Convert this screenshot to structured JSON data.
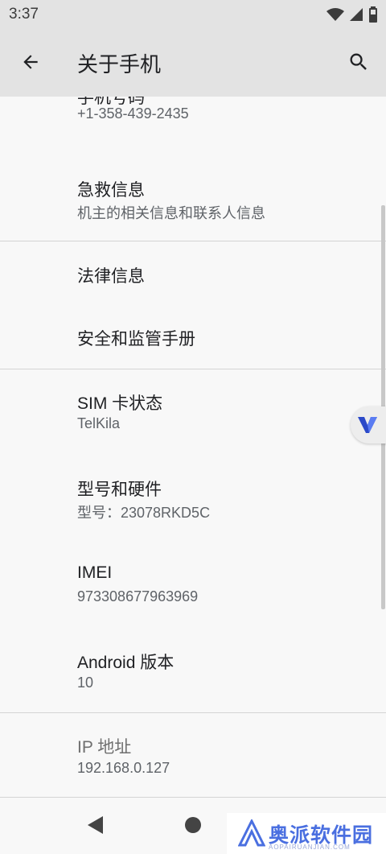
{
  "status_bar": {
    "time": "3:37"
  },
  "header": {
    "title": "关于手机"
  },
  "items": [
    {
      "title": "手机号码",
      "subtitle": "+1-358-439-2435"
    },
    {
      "title": "急救信息",
      "subtitle": "机主的相关信息和联系人信息"
    },
    {
      "title": "法律信息"
    },
    {
      "title": "安全和监管手册"
    },
    {
      "title": "SIM 卡状态",
      "subtitle": "TelKila"
    },
    {
      "title": "型号和硬件",
      "subtitle": "型号：23078RKD5C"
    },
    {
      "title": "IMEI",
      "subtitle": "973308677963969"
    },
    {
      "title": "Android 版本",
      "subtitle": "10"
    },
    {
      "title": "IP 地址",
      "subtitle": "192.168.0.127"
    }
  ],
  "watermark": {
    "text": "奥派软件园",
    "sub": "AOPAIRUANJIAN.COM"
  },
  "colors": {
    "app_bar": "#e3e3e3",
    "background": "#f8f8f8",
    "accent": "#4a6fe0"
  }
}
